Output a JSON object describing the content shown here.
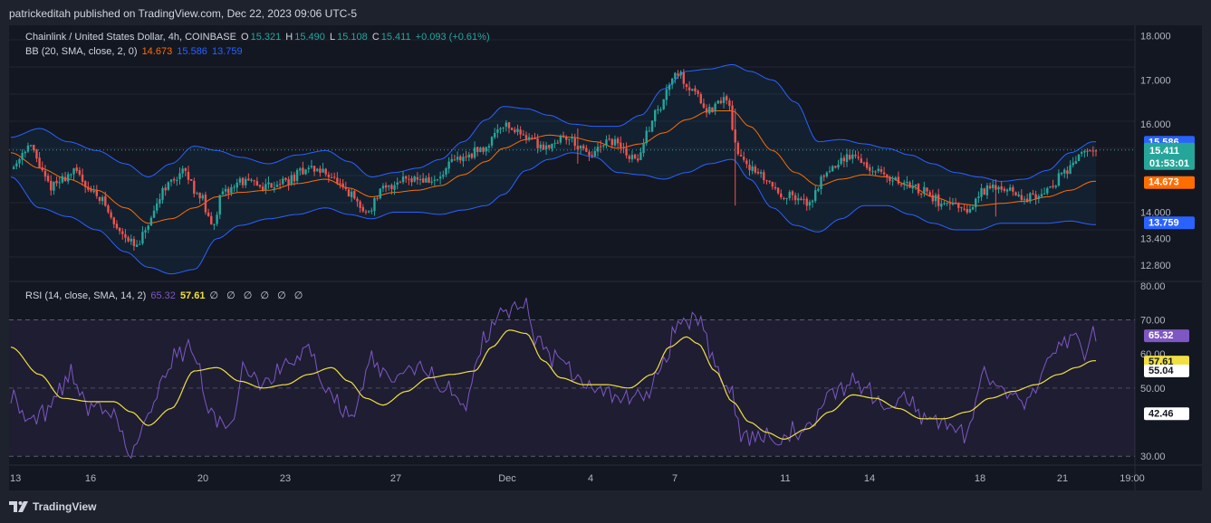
{
  "header": {
    "publisher_line": "patrickeditah published on TradingView.com, Dec 22, 2023 09:06 UTC-5"
  },
  "legend_main": {
    "symbol": "Chainlink / United States Dollar, 4h, COINBASE",
    "o_label": "O",
    "o_value": "15.321",
    "h_label": "H",
    "h_value": "15.490",
    "l_label": "L",
    "l_value": "15.108",
    "c_label": "C",
    "c_value": "15.411",
    "change": "+0.093 (+0.61%)"
  },
  "legend_bb": {
    "label": "BB (20, SMA, close, 2, 0)",
    "basis": "14.673",
    "upper": "15.586",
    "lower": "13.759"
  },
  "legend_rsi": {
    "label": "RSI (14, close, SMA, 14, 2)",
    "rsi": "65.32",
    "ma": "57.61",
    "placeholders": "∅ ∅ ∅ ∅ ∅ ∅"
  },
  "footer": {
    "brand": "TradingView"
  },
  "colors": {
    "up": "#26a69a",
    "down": "#ef5350",
    "bb_band": "#2962ff",
    "bb_basis": "#ff6d00",
    "rsi": "#7e57c2",
    "rsi_ma": "#f0e040",
    "bg": "#131722",
    "frame": "#1e222d"
  },
  "icons": {
    "brand_logo": "tradingview-logo-icon"
  },
  "chart_data": [
    {
      "type": "candlestick",
      "title": "Chainlink / United States Dollar, 4h, COINBASE",
      "price_ticks": [
        "18.000",
        "17.000",
        "16.000",
        "14.000",
        "13.400",
        "12.800"
      ],
      "x_ticks": [
        "13",
        "16",
        "20",
        "23",
        "27",
        "Dec",
        "4",
        "7",
        "11",
        "14",
        "18",
        "21",
        "19:00"
      ],
      "ylim": [
        12.45,
        18.2
      ],
      "last": {
        "price": "15.411",
        "countdown": "01:53:01"
      },
      "bb_tags": {
        "upper": "15.586",
        "basis": "14.673",
        "lower": "13.759"
      },
      "price_anchors": [
        [
          0,
          15.0
        ],
        [
          6,
          15.5
        ],
        [
          14,
          14.6
        ],
        [
          22,
          14.9
        ],
        [
          30,
          14.4
        ],
        [
          38,
          13.6
        ],
        [
          44,
          13.2
        ],
        [
          48,
          13.7
        ],
        [
          54,
          14.6
        ],
        [
          60,
          14.9
        ],
        [
          66,
          14.4
        ],
        [
          70,
          13.7
        ],
        [
          74,
          14.4
        ],
        [
          80,
          14.7
        ],
        [
          88,
          14.6
        ],
        [
          96,
          14.7
        ],
        [
          104,
          15.0
        ],
        [
          110,
          14.9
        ],
        [
          118,
          14.4
        ],
        [
          124,
          14.0
        ],
        [
          130,
          14.5
        ],
        [
          138,
          14.8
        ],
        [
          148,
          14.7
        ],
        [
          156,
          15.2
        ],
        [
          164,
          15.4
        ],
        [
          172,
          16.0
        ],
        [
          178,
          15.8
        ],
        [
          186,
          15.5
        ],
        [
          194,
          15.7
        ],
        [
          202,
          15.3
        ],
        [
          210,
          15.6
        ],
        [
          218,
          15.2
        ],
        [
          226,
          16.3
        ],
        [
          232,
          17.2
        ],
        [
          238,
          16.8
        ],
        [
          244,
          16.3
        ],
        [
          250,
          16.6
        ],
        [
          254,
          15.3
        ],
        [
          262,
          14.8
        ],
        [
          270,
          14.4
        ],
        [
          278,
          14.2
        ],
        [
          286,
          15.0
        ],
        [
          294,
          15.3
        ],
        [
          302,
          14.9
        ],
        [
          310,
          14.7
        ],
        [
          318,
          14.5
        ],
        [
          326,
          14.2
        ],
        [
          334,
          14.0
        ],
        [
          340,
          14.5
        ],
        [
          346,
          14.6
        ],
        [
          354,
          14.3
        ],
        [
          362,
          14.5
        ],
        [
          368,
          14.9
        ],
        [
          374,
          15.3
        ],
        [
          378,
          15.4
        ]
      ],
      "bb_anchors": [
        [
          0,
          15.7,
          15.35,
          14.8
        ],
        [
          10,
          15.9,
          15.0,
          14.1
        ],
        [
          20,
          15.6,
          14.75,
          13.9
        ],
        [
          30,
          15.4,
          14.5,
          13.6
        ],
        [
          40,
          15.1,
          14.1,
          13.1
        ],
        [
          48,
          14.8,
          13.75,
          12.75
        ],
        [
          56,
          15.1,
          13.85,
          12.6
        ],
        [
          64,
          15.5,
          14.1,
          12.7
        ],
        [
          72,
          15.4,
          14.35,
          13.4
        ],
        [
          80,
          15.25,
          14.45,
          13.7
        ],
        [
          90,
          15.1,
          14.5,
          13.85
        ],
        [
          100,
          15.3,
          14.65,
          13.95
        ],
        [
          110,
          15.4,
          14.75,
          14.1
        ],
        [
          118,
          15.15,
          14.55,
          13.95
        ],
        [
          126,
          14.8,
          14.35,
          13.85
        ],
        [
          134,
          14.9,
          14.45,
          14.0
        ],
        [
          142,
          15.0,
          14.5,
          14.0
        ],
        [
          150,
          15.2,
          14.6,
          13.95
        ],
        [
          158,
          15.6,
          14.85,
          14.05
        ],
        [
          166,
          16.1,
          15.15,
          14.15
        ],
        [
          172,
          16.4,
          15.45,
          14.4
        ],
        [
          180,
          16.35,
          15.65,
          14.95
        ],
        [
          188,
          16.2,
          15.75,
          15.2
        ],
        [
          196,
          16.0,
          15.7,
          15.35
        ],
        [
          204,
          15.95,
          15.6,
          15.25
        ],
        [
          212,
          15.95,
          15.45,
          14.9
        ],
        [
          220,
          16.2,
          15.55,
          14.85
        ],
        [
          228,
          16.8,
          15.8,
          14.75
        ],
        [
          236,
          17.2,
          16.1,
          14.9
        ],
        [
          244,
          17.25,
          16.3,
          15.1
        ],
        [
          252,
          17.35,
          16.3,
          15.2
        ],
        [
          258,
          17.2,
          15.95,
          14.75
        ],
        [
          266,
          17.0,
          15.4,
          14.1
        ],
        [
          274,
          16.5,
          14.9,
          13.7
        ],
        [
          282,
          15.6,
          14.6,
          13.55
        ],
        [
          290,
          15.65,
          14.75,
          13.85
        ],
        [
          298,
          15.55,
          14.85,
          14.15
        ],
        [
          306,
          15.45,
          14.8,
          14.15
        ],
        [
          314,
          15.3,
          14.6,
          13.95
        ],
        [
          322,
          15.1,
          14.35,
          13.75
        ],
        [
          330,
          14.9,
          14.2,
          13.6
        ],
        [
          338,
          14.8,
          14.15,
          13.6
        ],
        [
          346,
          14.7,
          14.2,
          13.75
        ],
        [
          354,
          14.75,
          14.25,
          13.75
        ],
        [
          362,
          14.95,
          14.35,
          13.75
        ],
        [
          370,
          15.35,
          14.5,
          13.8
        ],
        [
          378,
          15.6,
          14.7,
          13.72
        ]
      ],
      "spikes": [
        [
          253,
          16.35,
          14.15
        ],
        [
          344,
          14.15,
          13.9
        ],
        [
          198,
          15.9,
          15.1
        ]
      ],
      "series": [
        {
          "name": "BB upper",
          "last": "15.586"
        },
        {
          "name": "BB basis",
          "last": "14.673"
        },
        {
          "name": "BB lower",
          "last": "13.759"
        }
      ]
    },
    {
      "type": "line",
      "title": "RSI (14, close, SMA, 14, 2)",
      "y_ticks": [
        "80.00",
        "70.00",
        "60.00",
        "50.00",
        "30.00"
      ],
      "ylim": [
        29,
        81
      ],
      "bands": {
        "upper": 70,
        "middle": 50,
        "lower": 30
      },
      "tags": {
        "rsi": "65.32",
        "ma": "57.61",
        "mark_a": "55.04",
        "mark_b": "42.46"
      },
      "rsi_anchors": [
        [
          0,
          50
        ],
        [
          6,
          40
        ],
        [
          12,
          44
        ],
        [
          20,
          53
        ],
        [
          28,
          46
        ],
        [
          36,
          41
        ],
        [
          42,
          31
        ],
        [
          48,
          42
        ],
        [
          54,
          56
        ],
        [
          62,
          63
        ],
        [
          70,
          44
        ],
        [
          76,
          38
        ],
        [
          82,
          55
        ],
        [
          90,
          52
        ],
        [
          98,
          57
        ],
        [
          104,
          62
        ],
        [
          110,
          50
        ],
        [
          118,
          41
        ],
        [
          126,
          57
        ],
        [
          134,
          53
        ],
        [
          142,
          58
        ],
        [
          150,
          50
        ],
        [
          158,
          46
        ],
        [
          166,
          64
        ],
        [
          172,
          72
        ],
        [
          178,
          75
        ],
        [
          184,
          65
        ],
        [
          190,
          60
        ],
        [
          198,
          52
        ],
        [
          206,
          50
        ],
        [
          214,
          48
        ],
        [
          222,
          47
        ],
        [
          228,
          57
        ],
        [
          234,
          70
        ],
        [
          240,
          72
        ],
        [
          244,
          60
        ],
        [
          250,
          50
        ],
        [
          256,
          37
        ],
        [
          262,
          35
        ],
        [
          268,
          34
        ],
        [
          274,
          36
        ],
        [
          280,
          40
        ],
        [
          288,
          50
        ],
        [
          296,
          52
        ],
        [
          304,
          44
        ],
        [
          312,
          47
        ],
        [
          320,
          42
        ],
        [
          328,
          40
        ],
        [
          334,
          38
        ],
        [
          340,
          55
        ],
        [
          348,
          48
        ],
        [
          356,
          47
        ],
        [
          364,
          60
        ],
        [
          370,
          65
        ],
        [
          376,
          62
        ],
        [
          378,
          65
        ]
      ],
      "ma_anchors": [
        [
          0,
          62
        ],
        [
          10,
          54
        ],
        [
          18,
          47
        ],
        [
          28,
          46
        ],
        [
          36,
          46
        ],
        [
          42,
          43
        ],
        [
          48,
          39
        ],
        [
          56,
          44
        ],
        [
          64,
          55
        ],
        [
          72,
          56
        ],
        [
          80,
          52
        ],
        [
          88,
          50
        ],
        [
          96,
          51
        ],
        [
          104,
          54
        ],
        [
          112,
          56
        ],
        [
          118,
          52
        ],
        [
          124,
          47
        ],
        [
          130,
          45
        ],
        [
          138,
          49
        ],
        [
          146,
          53
        ],
        [
          154,
          54
        ],
        [
          162,
          55
        ],
        [
          168,
          62
        ],
        [
          174,
          67
        ],
        [
          180,
          66
        ],
        [
          186,
          58
        ],
        [
          192,
          53
        ],
        [
          200,
          51
        ],
        [
          208,
          51
        ],
        [
          216,
          50
        ],
        [
          224,
          54
        ],
        [
          230,
          62
        ],
        [
          236,
          65
        ],
        [
          240,
          63
        ],
        [
          246,
          55
        ],
        [
          252,
          46
        ],
        [
          258,
          40
        ],
        [
          264,
          37
        ],
        [
          270,
          35
        ],
        [
          278,
          38
        ],
        [
          286,
          43
        ],
        [
          294,
          48
        ],
        [
          302,
          47
        ],
        [
          310,
          44
        ],
        [
          318,
          41
        ],
        [
          326,
          41
        ],
        [
          334,
          43
        ],
        [
          342,
          47
        ],
        [
          350,
          49
        ],
        [
          358,
          51
        ],
        [
          366,
          54
        ],
        [
          372,
          56
        ],
        [
          378,
          58
        ]
      ]
    }
  ]
}
